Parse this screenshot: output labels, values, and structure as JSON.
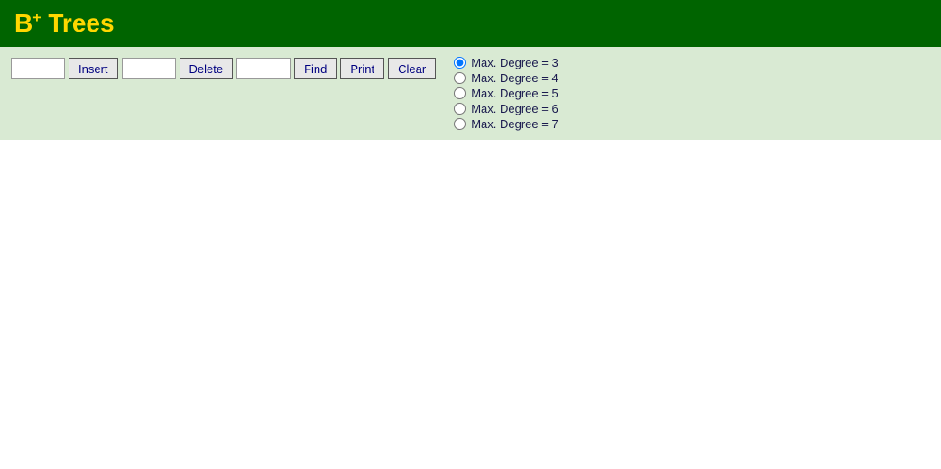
{
  "header": {
    "title_b": "B",
    "title_sup": "+",
    "title_rest": " Trees"
  },
  "toolbar": {
    "insert_input_placeholder": "",
    "insert_label": "Insert",
    "delete_input_placeholder": "",
    "delete_label": "Delete",
    "find_input_placeholder": "",
    "find_label": "Find",
    "print_label": "Print",
    "clear_label": "Clear"
  },
  "radio_group": {
    "options": [
      {
        "label": "Max. Degree = 3",
        "value": "3",
        "checked": true
      },
      {
        "label": "Max. Degree = 4",
        "value": "4",
        "checked": false
      },
      {
        "label": "Max. Degree = 5",
        "value": "5",
        "checked": false
      },
      {
        "label": "Max. Degree = 6",
        "value": "6",
        "checked": false
      },
      {
        "label": "Max. Degree = 7",
        "value": "7",
        "checked": false
      }
    ]
  }
}
